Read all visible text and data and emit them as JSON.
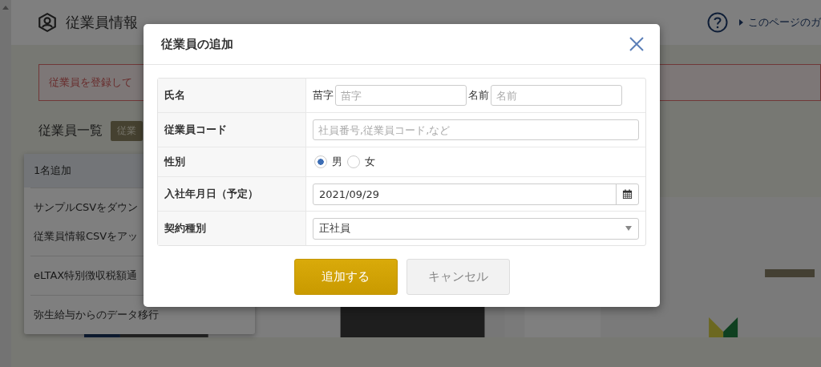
{
  "page": {
    "title": "従業員情報",
    "guide_link": "このページのガ",
    "alert": "従業員を登録して",
    "list_heading": "従業員一覧",
    "list_badge": "従業"
  },
  "menu": {
    "groups": [
      [
        {
          "label": "1名追加",
          "selected": true
        }
      ],
      [
        {
          "label": "サンプルCSVをダウン",
          "selected": false
        },
        {
          "label": "従業員情報CSVをアッ",
          "selected": false
        }
      ],
      [
        {
          "label": "eLTAX特別徴収税額通",
          "selected": false
        }
      ],
      [
        {
          "label": "弥生給与からのデータ移行",
          "selected": false
        }
      ]
    ]
  },
  "dialog": {
    "title": "従業員の追加",
    "fields": [
      {
        "kind": "name",
        "label": "氏名",
        "parts": [
          {
            "label": "苗字",
            "placeholder": "苗字"
          },
          {
            "label": "名前",
            "placeholder": "名前"
          }
        ]
      },
      {
        "kind": "text",
        "label": "従業員コード",
        "placeholder": "社員番号,従業員コード,など"
      },
      {
        "kind": "radio",
        "label": "性別",
        "options": [
          {
            "label": "男",
            "selected": true
          },
          {
            "label": "女",
            "selected": false
          }
        ]
      },
      {
        "kind": "date",
        "label": "入社年月日（予定）",
        "value": "2021/09/29"
      },
      {
        "kind": "select",
        "label": "契約種別",
        "value": "正社員"
      }
    ],
    "buttons": [
      {
        "label": "追加する",
        "kind": "primary"
      },
      {
        "label": "キャンセル",
        "kind": "secondary"
      }
    ]
  }
}
